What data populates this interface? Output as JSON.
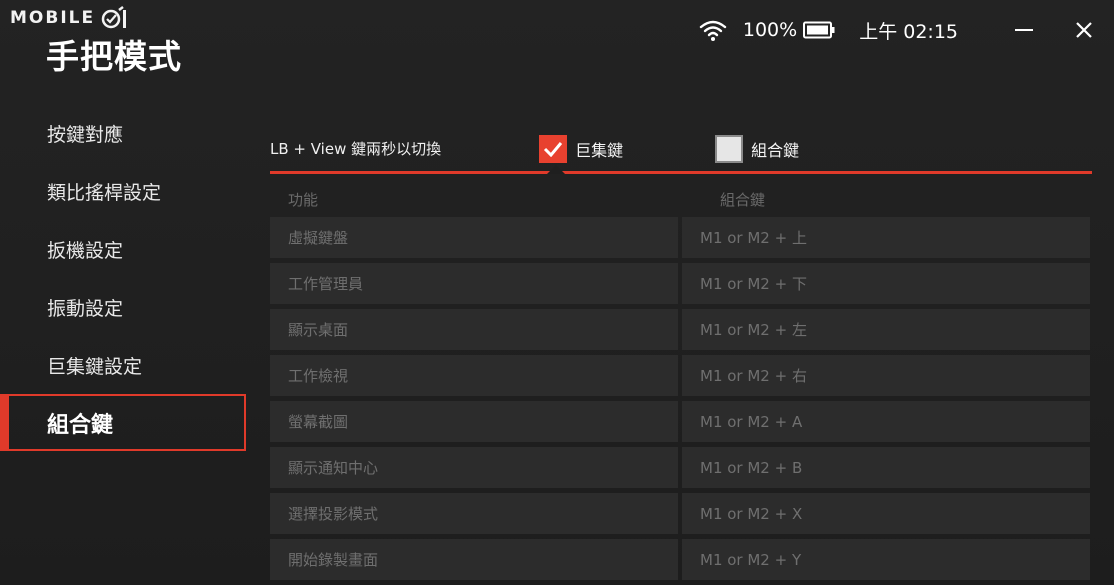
{
  "watermark": "MOBILE",
  "page_title": "手把模式",
  "status": {
    "battery_percent": "100%",
    "time": "上午 02:15"
  },
  "sidebar": {
    "items": [
      {
        "label": "按鍵對應"
      },
      {
        "label": "類比搖桿設定"
      },
      {
        "label": "扳機設定"
      },
      {
        "label": "振動設定"
      },
      {
        "label": "巨集鍵設定"
      },
      {
        "label": "組合鍵",
        "active": true
      }
    ]
  },
  "mode": {
    "label": "LB + View 鍵兩秒以切換",
    "options": [
      {
        "label": "巨集鍵",
        "checked": true
      },
      {
        "label": "組合鍵",
        "checked": false
      }
    ]
  },
  "table": {
    "headers": [
      "功能",
      "組合鍵"
    ],
    "rows": [
      {
        "function": "虛擬鍵盤",
        "combo": "M1 or M2 + 上"
      },
      {
        "function": "工作管理員",
        "combo": "M1 or M2 + 下"
      },
      {
        "function": "顯示桌面",
        "combo": "M1 or M2 + 左"
      },
      {
        "function": "工作檢視",
        "combo": "M1 or M2 + 右"
      },
      {
        "function": "螢幕截圖",
        "combo": "M1 or M2 + A"
      },
      {
        "function": "顯示通知中心",
        "combo": "M1 or M2 + B"
      },
      {
        "function": "選擇投影模式",
        "combo": "M1 or M2 + X"
      },
      {
        "function": "開始錄製畫面",
        "combo": "M1 or M2 + Y"
      }
    ]
  },
  "colors": {
    "accent": "#e03a2a",
    "background": "#1e1e1e",
    "cell": "#2c2c2c"
  },
  "icons": [
    "wifi-icon",
    "battery-icon",
    "minimize-icon",
    "close-icon",
    "checkmark-icon"
  ]
}
